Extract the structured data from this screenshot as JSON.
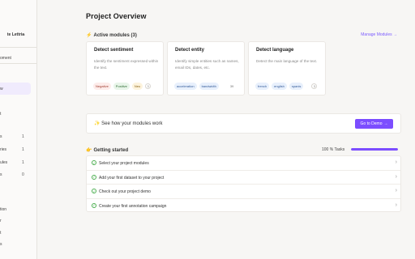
{
  "sidebar": {
    "workspace": "te Lettria",
    "items": [
      {
        "label": "oment"
      },
      {
        "label": "w"
      },
      {
        "label": "t"
      },
      {
        "label": "s",
        "count": "1"
      },
      {
        "label": "ries",
        "count": "1"
      },
      {
        "label": "ules",
        "count": "1"
      },
      {
        "label": "s",
        "count": "0"
      },
      {
        "label": "tion"
      },
      {
        "label": "r"
      },
      {
        "label": "t"
      },
      {
        "label": "s"
      }
    ]
  },
  "page": {
    "title": "Project Overview"
  },
  "modules": {
    "icon": "lightning-icon",
    "heading": "Active modules (3)",
    "manage_label": "Manage Modules",
    "cards": [
      {
        "title": "Detect sentiment",
        "description": "Identify the sentiment expressed within the text.",
        "tags": [
          "Negative",
          "Positive",
          "Neu"
        ],
        "more": "3"
      },
      {
        "title": "Detect entity",
        "description": "Identify simple entities such as names, email IDs, dates, etc.",
        "tags": [
          "acceleration",
          "bandwidth"
        ],
        "count": "39"
      },
      {
        "title": "Detect language",
        "description": "Detect the main language of the text.",
        "tags": [
          "french",
          "english",
          "spanis"
        ],
        "more": "3"
      }
    ]
  },
  "demo": {
    "icon": "sparkle-icon",
    "label": "See how your modules work",
    "button_label": "Go to Demo"
  },
  "getting_started": {
    "icon": "hand-icon",
    "heading": "Getting started",
    "progress_text": "100   % Tasks",
    "progress_value": 1.0,
    "tasks": [
      {
        "label": "Select your project modules"
      },
      {
        "label": "Add your first dataset to your project"
      },
      {
        "label": "Check out your project demo"
      },
      {
        "label": "Create your first annotation campaign"
      }
    ]
  },
  "colors": {
    "accent": "#7c4dff",
    "success": "#4caf50"
  }
}
